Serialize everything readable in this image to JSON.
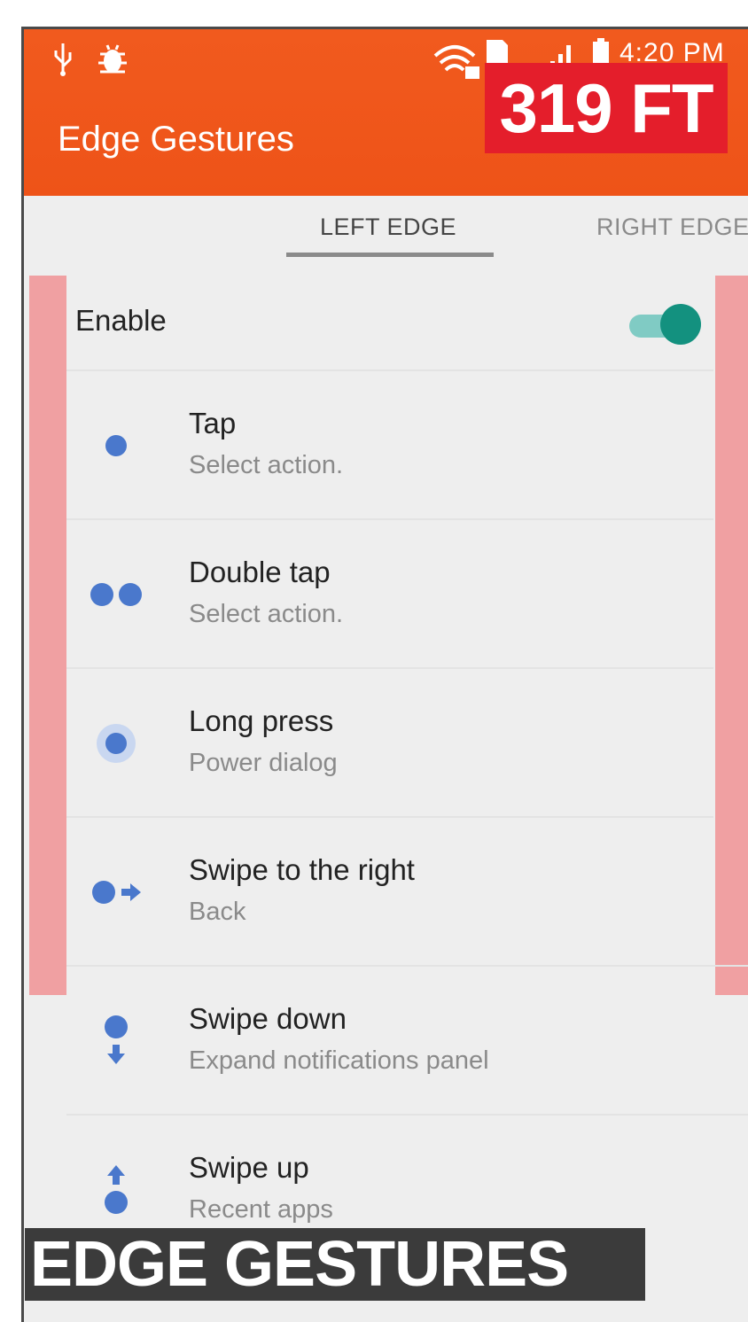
{
  "status_bar": {
    "time": "4:20 PM",
    "icons": [
      "usb-icon",
      "bug-icon",
      "wifi-lock-icon",
      "sim-card-icon",
      "signal-icon",
      "battery-icon"
    ]
  },
  "app_bar": {
    "title": "Edge Gestures",
    "color": "#f15a1e"
  },
  "overlay": {
    "distance_badge": "319 FT",
    "caption": "EDGE GESTURES"
  },
  "tabs": [
    {
      "label": "LEFT EDGE",
      "selected": true
    },
    {
      "label": "RIGHT EDGE",
      "selected": false
    }
  ],
  "enable": {
    "label": "Enable",
    "checked": true,
    "accent": "#13917f"
  },
  "gestures": [
    {
      "title": "Tap",
      "subtitle": "Select action.",
      "icon": "single-dot-icon"
    },
    {
      "title": "Double tap",
      "subtitle": "Select action.",
      "icon": "double-dot-icon"
    },
    {
      "title": "Long press",
      "subtitle": "Power dialog",
      "icon": "halo-dot-icon"
    },
    {
      "title": "Swipe to the right",
      "subtitle": "Back",
      "icon": "arrow-right-dot-icon"
    },
    {
      "title": "Swipe down",
      "subtitle": "Expand notifications panel",
      "icon": "arrow-down-dot-icon"
    },
    {
      "title": "Swipe up",
      "subtitle": "Recent apps",
      "icon": "arrow-up-dot-icon"
    }
  ],
  "colors": {
    "edge_highlight": "#f0a0a2",
    "gesture_icon": "#4a78cc",
    "badge": "#e41e2b"
  }
}
